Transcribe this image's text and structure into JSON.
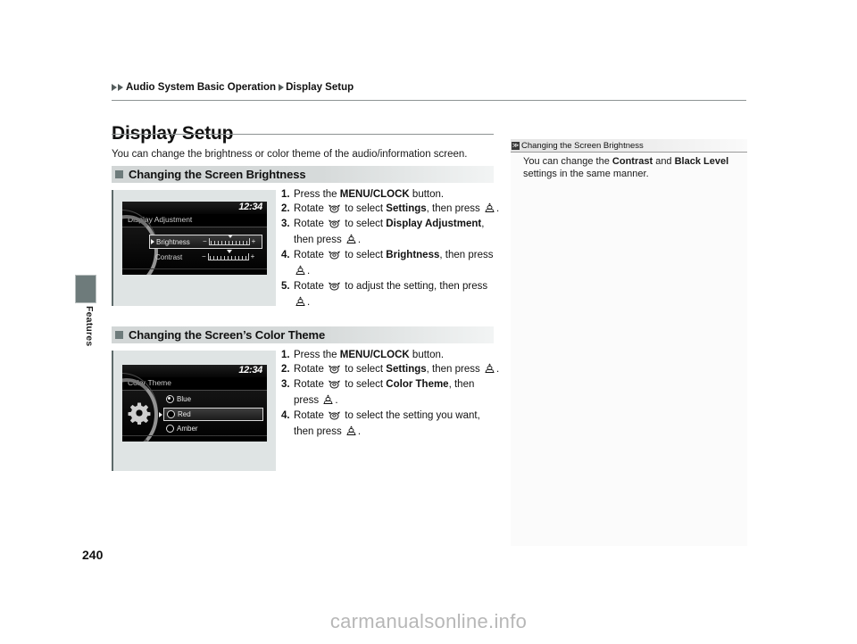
{
  "side": {
    "tab_label": "Features"
  },
  "breadcrumb": {
    "item1": "Audio System Basic Operation",
    "item2": "Display Setup"
  },
  "page": {
    "title": "Display Setup",
    "intro": "You can change the brightness or color theme of the audio/information screen.",
    "number": "240",
    "watermark": "carmanualsonline.info"
  },
  "sections": [
    {
      "title": "Changing the Screen Brightness",
      "figure": {
        "clock": "12:34",
        "heading": "Display Adjustment",
        "rows": [
          {
            "label": "Brightness",
            "minus": "−",
            "plus": "+",
            "selected": true
          },
          {
            "label": "Contrast",
            "minus": "−",
            "plus": "+",
            "selected": false
          }
        ]
      },
      "steps": [
        {
          "num": "1.",
          "text": "Press the <b>MENU/CLOCK</b> button."
        },
        {
          "num": "2.",
          "text": "Rotate <span class=\"ic\" data-name=\"rotate-knob-icon\"></span> to select <b>Settings</b>, then press <span class=\"ic\" data-name=\"press-knob-icon\"></span>."
        },
        {
          "num": "3.",
          "text": "Rotate <span class=\"ic\" data-name=\"rotate-knob-icon\"></span> to select <b>Display Adjustment</b>, then press <span class=\"ic\" data-name=\"press-knob-icon\"></span>."
        },
        {
          "num": "4.",
          "text": "Rotate <span class=\"ic\" data-name=\"rotate-knob-icon\"></span> to select <b>Brightness</b>, then press <span class=\"ic\" data-name=\"press-knob-icon\"></span>."
        },
        {
          "num": "5.",
          "text": "Rotate <span class=\"ic\" data-name=\"rotate-knob-icon\"></span> to adjust the setting, then press <span class=\"ic\" data-name=\"press-knob-icon\"></span>."
        }
      ]
    },
    {
      "title": "Changing the Screen’s Color Theme",
      "figure": {
        "clock": "12:34",
        "heading": "Color Theme",
        "rows": [
          {
            "label": "Blue",
            "checked": true,
            "selected": false
          },
          {
            "label": "Red",
            "checked": false,
            "selected": true
          },
          {
            "label": "Amber",
            "checked": false,
            "selected": false
          }
        ]
      },
      "steps": [
        {
          "num": "1.",
          "text": "Press the <b>MENU/CLOCK</b> button."
        },
        {
          "num": "2.",
          "text": "Rotate <span class=\"ic\" data-name=\"rotate-knob-icon\"></span> to select <b>Settings</b>, then press <span class=\"ic\" data-name=\"press-knob-icon\"></span>."
        },
        {
          "num": "3.",
          "text": "Rotate <span class=\"ic\" data-name=\"rotate-knob-icon\"></span> to select <b>Color Theme</b>, then press <span class=\"ic\" data-name=\"press-knob-icon\"></span>."
        },
        {
          "num": "4.",
          "text": "Rotate <span class=\"ic\" data-name=\"rotate-knob-icon\"></span> to select the setting you want, then press <span class=\"ic\" data-name=\"press-knob-icon\"></span>."
        }
      ]
    }
  ],
  "note": {
    "icon": "≫",
    "title": "Changing the Screen Brightness",
    "body": "You can change the <b>Contrast</b> and <b>Black Level</b> settings in the same manner."
  },
  "colors": {
    "accent": "#6e7b7b",
    "rule": "#8d9393",
    "figure_bg": "#dfe4e4",
    "screen_bg": "#000000",
    "watermark": "#b7b7b7"
  }
}
